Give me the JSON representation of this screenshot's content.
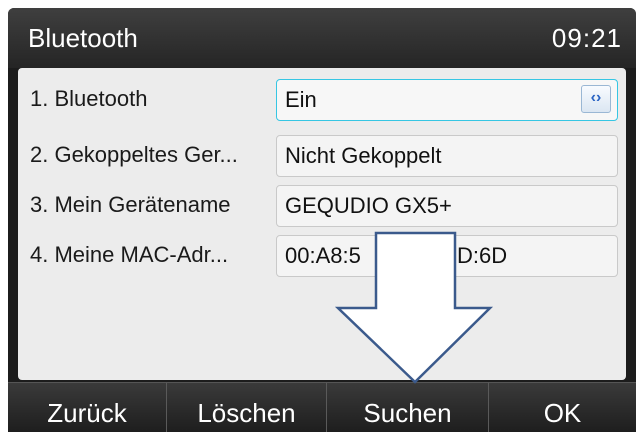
{
  "header": {
    "title": "Bluetooth",
    "time": "09:21"
  },
  "settings": [
    {
      "label": "1. Bluetooth",
      "value": "Ein",
      "control": "left-right-arrows-icon"
    },
    {
      "label": "2. Gekoppeltes Ger...",
      "value": "Nicht Gekoppelt"
    },
    {
      "label": "3. Mein Gerätename",
      "value": "GEQUDIO GX5+"
    },
    {
      "label": "4. Meine MAC-Adr...",
      "value": "00:A8:5"
    },
    {
      "value_suffix": "D:6D"
    }
  ],
  "softkeys": [
    "Zurück",
    "Löschen",
    "Suchen",
    "OK"
  ],
  "colors": {
    "accent": "#36c6e3",
    "arrow_outline": "#3b5a8c"
  },
  "overlay": {
    "icon": "down-arrow-icon"
  }
}
